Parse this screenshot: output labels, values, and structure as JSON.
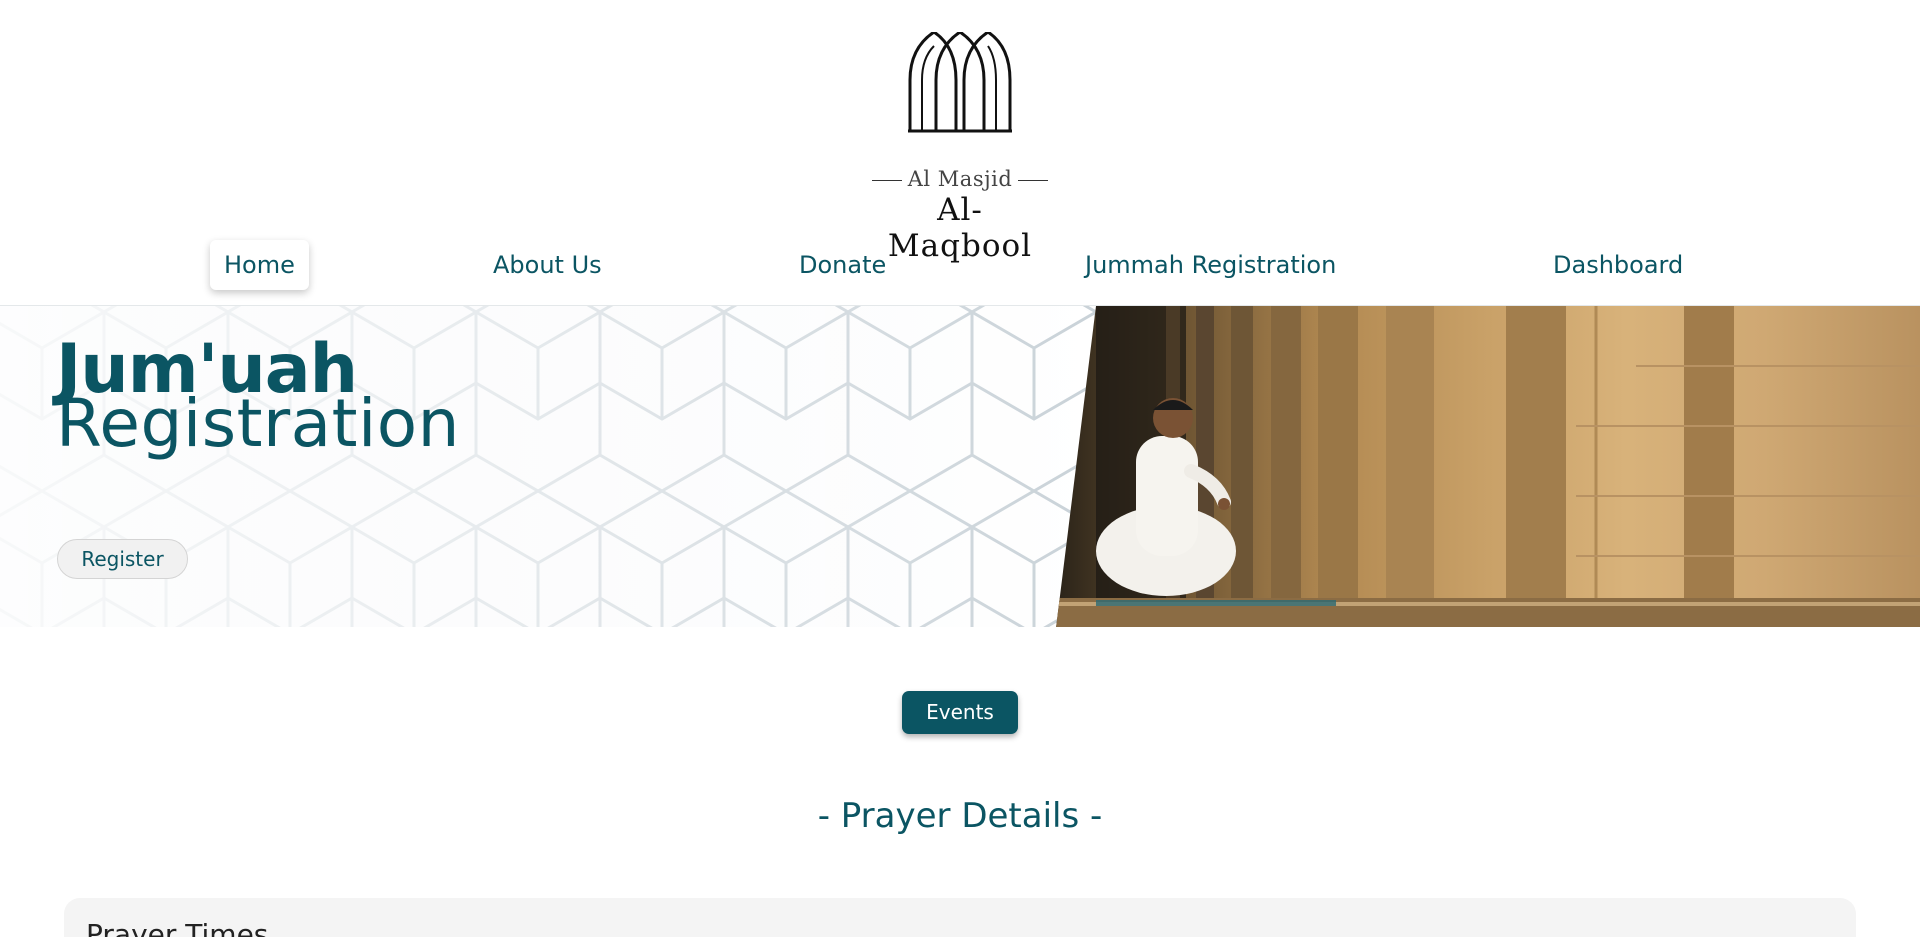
{
  "logo": {
    "subtitle": "Al Masjid",
    "name": "Al- Maqbool"
  },
  "nav": {
    "items": [
      {
        "label": "Home",
        "active": true
      },
      {
        "label": "About Us",
        "active": false
      },
      {
        "label": "Donate",
        "active": false
      },
      {
        "label": "Jummah Registration",
        "active": false
      },
      {
        "label": "Dashboard",
        "active": false
      }
    ]
  },
  "hero": {
    "title_line1": "Jum'uah",
    "title_line2": "Registration",
    "register_label": "Register"
  },
  "events_label": "Events",
  "prayer_section": {
    "heading": "- Prayer Details -",
    "panel_title": "Prayer Times"
  },
  "colors": {
    "brand": "#0b5563",
    "background": "#ffffff",
    "panel": "#f4f4f4"
  }
}
